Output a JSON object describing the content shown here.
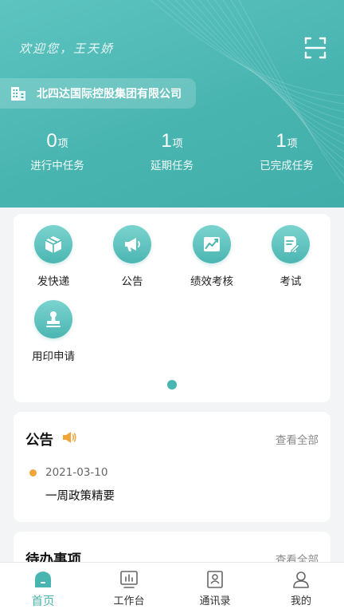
{
  "header": {
    "welcome": "欢迎您，王天娇",
    "company": "北四达国际控股集团有限公司",
    "stats": [
      {
        "value": "0",
        "unit": "项",
        "label": "进行中任务"
      },
      {
        "value": "1",
        "unit": "项",
        "label": "延期任务"
      },
      {
        "value": "1",
        "unit": "项",
        "label": "已完成任务"
      }
    ]
  },
  "grid": {
    "items": [
      {
        "label": "发快递",
        "icon": "package-icon"
      },
      {
        "label": "公告",
        "icon": "megaphone-icon"
      },
      {
        "label": "绩效考核",
        "icon": "chart-icon"
      },
      {
        "label": "考试",
        "icon": "exam-icon"
      },
      {
        "label": "用印申请",
        "icon": "stamp-icon"
      }
    ]
  },
  "notice": {
    "title": "公告",
    "view_all": "查看全部",
    "items": [
      {
        "date": "2021-03-10",
        "text": "一周政策精要"
      }
    ]
  },
  "todo": {
    "title": "待办事项",
    "view_all": "查看全部"
  },
  "tabbar": {
    "tabs": [
      {
        "label": "首页",
        "icon": "home-icon",
        "active": true
      },
      {
        "label": "工作台",
        "icon": "workbench-icon",
        "active": false
      },
      {
        "label": "通讯录",
        "icon": "contacts-icon",
        "active": false
      },
      {
        "label": "我的",
        "icon": "profile-icon",
        "active": false
      }
    ]
  },
  "colors": {
    "accent": "#49b5b1",
    "notice_dot": "#f0a43a",
    "megaphone": "#f0a43a"
  }
}
